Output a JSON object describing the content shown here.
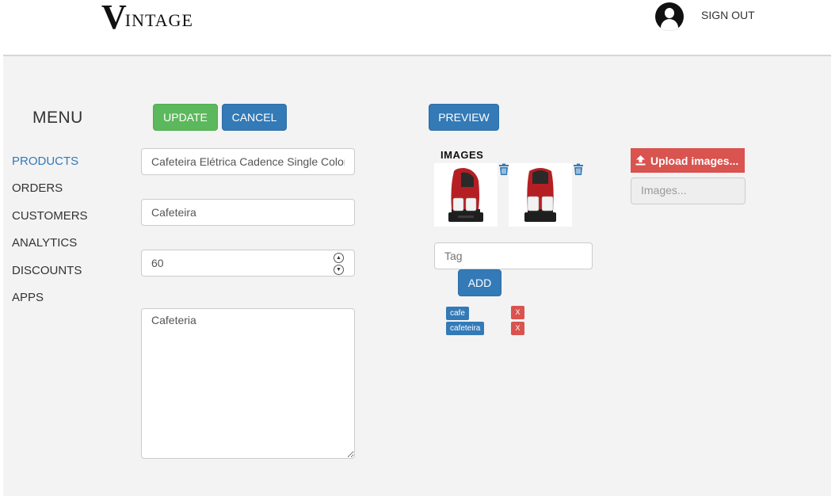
{
  "header": {
    "logo_initial": "V",
    "logo_rest": "INTAGE",
    "sign_out": "SIGN OUT"
  },
  "sidebar": {
    "title": "MENU",
    "items": [
      {
        "label": "PRODUCTS",
        "active": true
      },
      {
        "label": "ORDERS",
        "active": false
      },
      {
        "label": "CUSTOMERS",
        "active": false
      },
      {
        "label": "ANALYTICS",
        "active": false
      },
      {
        "label": "DISCOUNTS",
        "active": false
      },
      {
        "label": "APPS",
        "active": false
      }
    ]
  },
  "toolbar": {
    "update_label": "UPDATE",
    "cancel_label": "CANCEL",
    "preview_label": "PREVIEW"
  },
  "form": {
    "name_value": "Cafeteira Elétrica Cadence Single Colors",
    "type_value": "Cafeteira",
    "price_value": "60",
    "description_value": "Cafeteria"
  },
  "images": {
    "label": "IMAGES",
    "items": [
      {
        "alt": "coffee-maker-red"
      },
      {
        "alt": "coffee-maker-red-front"
      }
    ],
    "upload_label": "Upload images...",
    "field_placeholder": "Images..."
  },
  "tags": {
    "input_placeholder": "Tag",
    "add_label": "ADD",
    "remove_label": "X",
    "items": [
      "cafe",
      "cafeteira"
    ]
  },
  "colors": {
    "primary": "#337ab7",
    "success": "#5cb85c",
    "danger": "#d9534f",
    "background": "#f3f3f3"
  }
}
